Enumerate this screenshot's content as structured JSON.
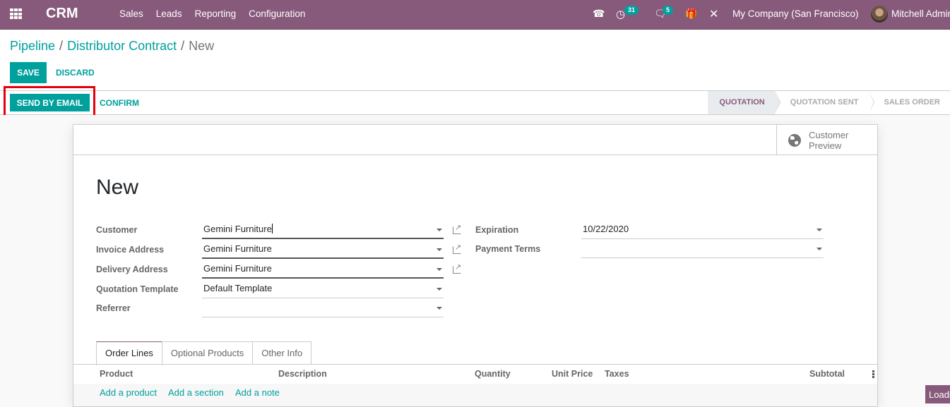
{
  "navbar": {
    "brand": "CRM",
    "menu": [
      "Sales",
      "Leads",
      "Reporting",
      "Configuration"
    ],
    "activity_count": "31",
    "message_count": "5",
    "company": "My Company (San Francisco)",
    "user": "Mitchell Admin",
    "colors": {
      "bar": "#875a7b",
      "badge": "#00a09d"
    }
  },
  "breadcrumb": {
    "items": [
      "Pipeline",
      "Distributor Contract"
    ],
    "current": "New"
  },
  "actions": {
    "save": "Save",
    "discard": "Discard"
  },
  "statusbar": {
    "send_by_email": "Send by Email",
    "confirm": "Confirm",
    "stages": [
      {
        "label": "Quotation",
        "current": true
      },
      {
        "label": "Quotation Sent",
        "current": false
      },
      {
        "label": "Sales Order",
        "current": false
      }
    ]
  },
  "sheet": {
    "customer_preview": "Customer Preview",
    "title": "New",
    "left_fields": [
      {
        "label": "Customer",
        "value": "Gemini Furniture"
      },
      {
        "label": "Invoice Address",
        "value": "Gemini Furniture"
      },
      {
        "label": "Delivery Address",
        "value": "Gemini Furniture"
      },
      {
        "label": "Quotation Template",
        "value": "Default Template"
      },
      {
        "label": "Referrer",
        "value": ""
      }
    ],
    "right_fields": [
      {
        "label": "Expiration",
        "value": "10/22/2020"
      },
      {
        "label": "Payment Terms",
        "value": ""
      }
    ]
  },
  "notebook": {
    "tabs": [
      "Order Lines",
      "Optional Products",
      "Other Info"
    ],
    "columns": [
      "Product",
      "Description",
      "Quantity",
      "Unit Price",
      "Taxes",
      "Subtotal"
    ],
    "add_links": [
      "Add a product",
      "Add a section",
      "Add a note"
    ]
  },
  "loading": "Loading"
}
